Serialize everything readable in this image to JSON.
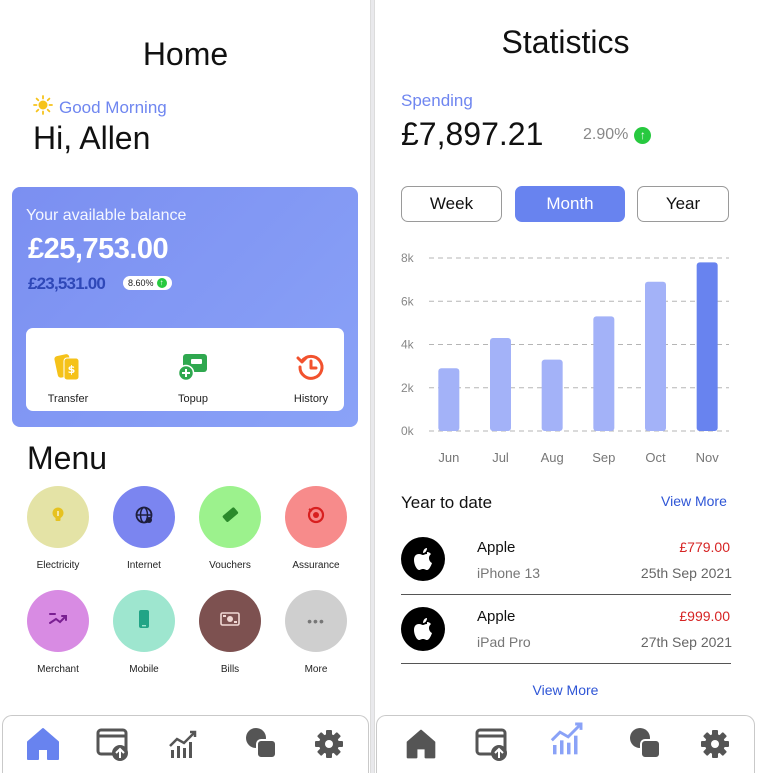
{
  "home": {
    "title": "Home",
    "greeting": "Good Morning",
    "user_greeting": "Hi, Allen",
    "balance": {
      "label": "Your available balance",
      "amount": "£25,753.00",
      "previous": "£23,531.00",
      "change": "8.60%"
    },
    "actions": [
      {
        "label": "Transfer",
        "icon": "transfer-icon"
      },
      {
        "label": "Topup",
        "icon": "topup-icon"
      },
      {
        "label": "History",
        "icon": "history-icon"
      }
    ],
    "menu_title": "Menu",
    "menu": [
      {
        "label": "Electricity",
        "icon": "lightbulb-icon",
        "color": "#e4e3a6"
      },
      {
        "label": "Internet",
        "icon": "globe-icon",
        "color": "#7b85f0"
      },
      {
        "label": "Vouchers",
        "icon": "ticket-icon",
        "color": "#9cf28d"
      },
      {
        "label": "Assurance",
        "icon": "shield-icon",
        "color": "#f78b8b"
      },
      {
        "label": "Merchant",
        "icon": "merchant-icon",
        "color": "#d88be3"
      },
      {
        "label": "Mobile",
        "icon": "phone-icon",
        "color": "#9ee6cf"
      },
      {
        "label": "Bills",
        "icon": "bills-icon",
        "color": "#7d5150"
      },
      {
        "label": "More",
        "icon": "more-icon",
        "color": "#cfcfcf"
      }
    ]
  },
  "stats": {
    "title": "Statistics",
    "spending_label": "Spending",
    "spending_amount": "£7,897.21",
    "spending_change": "2.90%",
    "periods": [
      "Week",
      "Month",
      "Year"
    ],
    "active_period": "Month",
    "ytd_title": "Year to date",
    "view_more": "View More",
    "transactions": [
      {
        "merchant": "Apple",
        "item": "iPhone 13",
        "amount": "£779.00",
        "date": "25th Sep 2021"
      },
      {
        "merchant": "Apple",
        "item": "iPad Pro",
        "amount": "£999.00",
        "date": "27th Sep 2021"
      }
    ]
  },
  "chart_data": {
    "type": "bar",
    "categories": [
      "Jun",
      "Jul",
      "Aug",
      "Sep",
      "Oct",
      "Nov"
    ],
    "values": [
      2900,
      4300,
      3300,
      5300,
      6900,
      7800
    ],
    "yticks": [
      "0k",
      "2k",
      "4k",
      "6k",
      "8k"
    ],
    "ylim": [
      0,
      8000
    ],
    "grid": true,
    "bar_color": "#a3b2f8",
    "highlight_color": "#6883ef"
  },
  "colors": {
    "accent": "#6883ef",
    "up": "#27c93f",
    "negative": "#d62424"
  }
}
